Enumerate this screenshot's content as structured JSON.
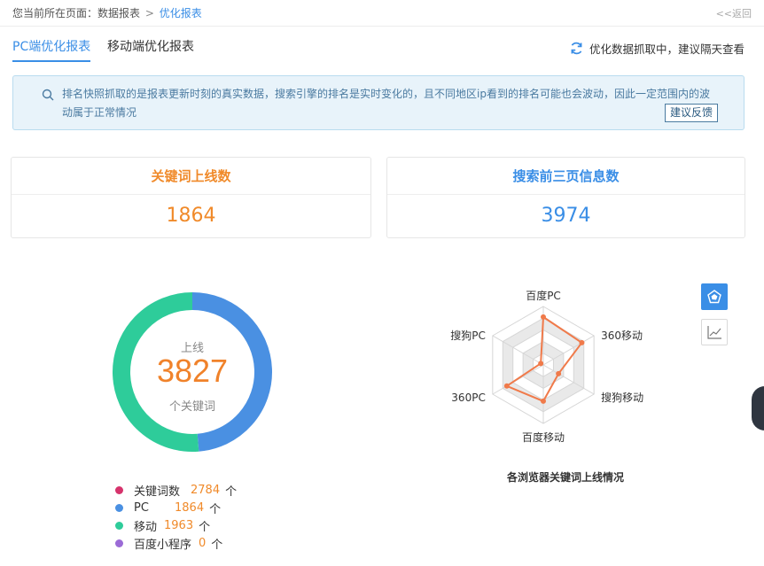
{
  "breadcrumb": {
    "prefix": "您当前所在页面：",
    "parent": "数据报表",
    "separator": ">",
    "current": "优化报表",
    "back": "<<返回"
  },
  "tabs": [
    {
      "label": "PC端优化报表",
      "active": true
    },
    {
      "label": "移动端优化报表",
      "active": false
    }
  ],
  "sync_status": {
    "icon": "refresh-icon",
    "text": "优化数据抓取中，建议隔天查看"
  },
  "notice": {
    "icon": "search-icon",
    "text": "排名快照抓取的是报表更新时刻的真实数据，搜索引擎的排名是实时变化的，且不同地区ip看到的排名可能也会波动，因此一定范围内的波动属于正常情况",
    "button": "建议反馈"
  },
  "stats": [
    {
      "title": "关键词上线数",
      "value": "1864",
      "color": "#f08a2a"
    },
    {
      "title": "搜索前三页信息数",
      "value": "3974",
      "color": "#3a8ee6"
    }
  ],
  "donut": {
    "label_top": "上线",
    "value": "3827",
    "label_bottom": "个关键词",
    "segments": [
      {
        "name": "PC",
        "value": 1864,
        "color": "#4a90e2"
      },
      {
        "name": "移动",
        "value": 1963,
        "color": "#2ecc9a"
      }
    ]
  },
  "legend": [
    {
      "name": "关键词数",
      "value": "2784",
      "unit": "个",
      "color": "#d6336c"
    },
    {
      "name": "PC",
      "value": "1864",
      "unit": "个",
      "color": "#4a90e2"
    },
    {
      "name": "移动",
      "value": "1963",
      "unit": "个",
      "color": "#2ecc9a"
    },
    {
      "name": "百度小程序",
      "value": "0",
      "unit": "个",
      "color": "#9b6bd6"
    }
  ],
  "chart_data": {
    "type": "radar",
    "title": "各浏览器关键词上线情况",
    "indicators": [
      "百度PC",
      "360移动",
      "搜狗移动",
      "百度移动",
      "360PC",
      "搜狗PC"
    ],
    "values": [
      0.82,
      0.76,
      0.3,
      0.62,
      0.72,
      0.05
    ],
    "series_color": "#f07a4a"
  },
  "view_buttons": [
    {
      "icon": "radar-chart-icon",
      "active": true
    },
    {
      "icon": "line-chart-icon",
      "active": false
    }
  ]
}
